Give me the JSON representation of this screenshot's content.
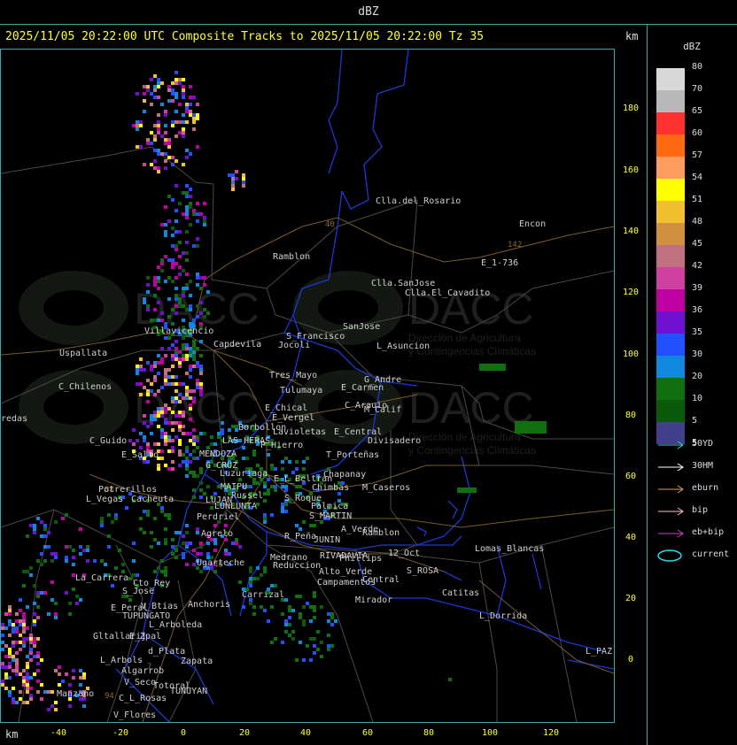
{
  "header": {
    "title": "dBZ"
  },
  "headline": "2025/11/05 20:22:00 UTC Composite Tracks to 2025/11/05 20:22:00 Tz 35",
  "axis_unit": "km",
  "y_ticks": [
    "180",
    "160",
    "140",
    "120",
    "100",
    "80",
    "60",
    "40",
    "20",
    "0"
  ],
  "x_ticks": [
    "-40",
    "-20",
    "0",
    "20",
    "40",
    "60",
    "80",
    "100",
    "120"
  ],
  "watermark": {
    "brand": "DACC",
    "line1": "Dirección de Agricultura",
    "line2": "y Contingencias Climáticas"
  },
  "legend": {
    "title": "dBZ",
    "levels": [
      {
        "label": "80",
        "color": "#d8d8d8"
      },
      {
        "label": "70",
        "color": "#b8b8b8"
      },
      {
        "label": "65",
        "color": "#ff3030"
      },
      {
        "label": "60",
        "color": "#ff6a10"
      },
      {
        "label": "57",
        "color": "#ff9a60"
      },
      {
        "label": "54",
        "color": "#ffff00"
      },
      {
        "label": "51",
        "color": "#f0c030"
      },
      {
        "label": "48",
        "color": "#d09040"
      },
      {
        "label": "45",
        "color": "#c07080"
      },
      {
        "label": "42",
        "color": "#d040a0"
      },
      {
        "label": "39",
        "color": "#c000a0"
      },
      {
        "label": "36",
        "color": "#7010d0"
      },
      {
        "label": "35",
        "color": "#2050ff"
      },
      {
        "label": "30",
        "color": "#1088e0"
      },
      {
        "label": "20",
        "color": "#107010"
      },
      {
        "label": "10",
        "color": "#0a5a0a"
      },
      {
        "label": "5",
        "color": "#40408a"
      }
    ],
    "bottom_label": "5",
    "tracks": [
      {
        "label": "50YD",
        "color": "#3fcfcf"
      },
      {
        "label": "30HM",
        "color": "#ffffff"
      },
      {
        "label": "eburn",
        "color": "#e0a060"
      },
      {
        "label": "bip",
        "color": "#ffc0c0"
      },
      {
        "label": "eb+bip",
        "color": "#d040d0"
      },
      {
        "label": "current",
        "color": "#30d8f0"
      }
    ]
  },
  "places": [
    {
      "name": "Clla.del_Rosario"
    },
    {
      "name": "Encon"
    },
    {
      "name": "E_1-736"
    },
    {
      "name": "Ramblon"
    },
    {
      "name": "Clla.SanJose"
    },
    {
      "name": "Clla.El_Cavadito"
    },
    {
      "name": "SanJose"
    },
    {
      "name": "S_Francisco"
    },
    {
      "name": "Villavicencio"
    },
    {
      "name": "Uspallata"
    },
    {
      "name": "Capdevila"
    },
    {
      "name": "Jocoli"
    },
    {
      "name": "L_Asuncion"
    },
    {
      "name": "Tres_Mayo"
    },
    {
      "name": "G_Andre"
    },
    {
      "name": "Tulumaya"
    },
    {
      "name": "E_Carmen"
    },
    {
      "name": "C_Chilenos"
    },
    {
      "name": "E_Chical"
    },
    {
      "name": "C_Arauio"
    },
    {
      "name": "E_Vergel"
    },
    {
      "name": "M_Calif"
    },
    {
      "name": "Borbollon"
    },
    {
      "name": "Lavioletas"
    },
    {
      "name": "E_Central"
    },
    {
      "name": "Divisadero"
    },
    {
      "name": "redas"
    },
    {
      "name": "LAS HERAS"
    },
    {
      "name": "P_Hierro"
    },
    {
      "name": "C_Guido"
    },
    {
      "name": "E_Salto"
    },
    {
      "name": "MENDOZA"
    },
    {
      "name": "T_Porteñas"
    },
    {
      "name": "G_CRUZ"
    },
    {
      "name": "Chapanay"
    },
    {
      "name": "Luzuriaga"
    },
    {
      "name": "E_L_Beltran"
    },
    {
      "name": "MAIPU"
    },
    {
      "name": "Chimbas"
    },
    {
      "name": "M_Caseros"
    },
    {
      "name": "Potrerillos"
    },
    {
      "name": "Russel"
    },
    {
      "name": "L_Vegas"
    },
    {
      "name": "Cacheuta"
    },
    {
      "name": "LUJAN"
    },
    {
      "name": "LUNLUNTA"
    },
    {
      "name": "S_Roque"
    },
    {
      "name": "Palmica"
    },
    {
      "name": "Perdriel"
    },
    {
      "name": "S_MARTIN"
    },
    {
      "name": "A_Verde"
    },
    {
      "name": "Ramblon"
    },
    {
      "name": "Agrelo"
    },
    {
      "name": "R_Peña"
    },
    {
      "name": "JUNIN"
    },
    {
      "name": "Lomas_Blancas"
    },
    {
      "name": "Ugarteche"
    },
    {
      "name": "Medrano"
    },
    {
      "name": "RIVADAVIA"
    },
    {
      "name": "Phillips"
    },
    {
      "name": "12_Oct"
    },
    {
      "name": "S_ROSA"
    },
    {
      "name": "Reduccion"
    },
    {
      "name": "Alto_Verde"
    },
    {
      "name": "La_Carrera"
    },
    {
      "name": "Cto_Rey"
    },
    {
      "name": "S_Jose"
    },
    {
      "name": "Campamentos"
    },
    {
      "name": "Central"
    },
    {
      "name": "Catitas"
    },
    {
      "name": "Carrizal"
    },
    {
      "name": "Mirador"
    },
    {
      "name": "Anchoris"
    },
    {
      "name": "E_Peral"
    },
    {
      "name": "V_Btias"
    },
    {
      "name": "TUPUNGATO"
    },
    {
      "name": "L_Dorrida"
    },
    {
      "name": "L_Arboleda"
    },
    {
      "name": "Gltallarij"
    },
    {
      "name": "E_Zpal"
    },
    {
      "name": "L_PAZ"
    },
    {
      "name": "L_Arbols"
    },
    {
      "name": "d_Plata"
    },
    {
      "name": "Zapata"
    },
    {
      "name": "Algarrob"
    },
    {
      "name": "V_Seco"
    },
    {
      "name": "Totoral"
    },
    {
      "name": "TUNUYAN"
    },
    {
      "name": "Manzano"
    },
    {
      "name": "C_L_Rosas"
    },
    {
      "name": "V_Flores"
    }
  ],
  "route_numbers": [
    "40",
    "142",
    "88",
    "94",
    "7",
    "40"
  ]
}
